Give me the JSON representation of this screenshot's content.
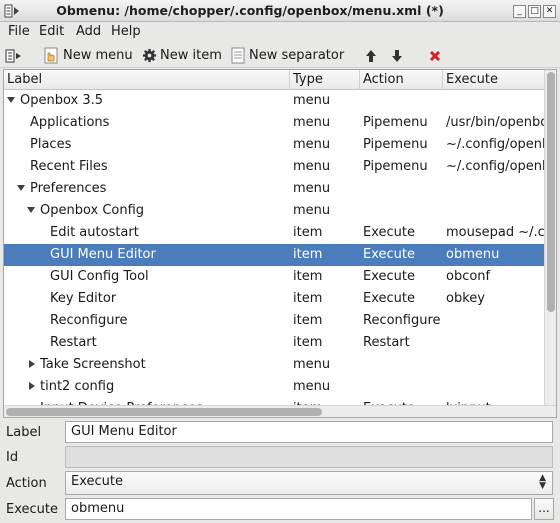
{
  "window": {
    "title": "Obmenu: /home/chopper/.config/openbox/menu.xml (*)",
    "buttons": [
      "_",
      "□",
      "✕"
    ]
  },
  "menubar": [
    "File",
    "Edit",
    "Add",
    "Help"
  ],
  "toolbar": {
    "new_menu": "New menu",
    "new_item": "New item",
    "new_separator": "New separator"
  },
  "tree": {
    "columns": [
      "Label",
      "Type",
      "Action",
      "Execute"
    ],
    "rows": [
      {
        "label": "Openbox 3.5",
        "type": "menu",
        "action": "",
        "execute": "",
        "depth": 0,
        "expander": "expanded"
      },
      {
        "label": "Applications",
        "type": "menu",
        "action": "Pipemenu",
        "execute": "/usr/bin/openbox",
        "depth": 1,
        "expander": "none"
      },
      {
        "label": "Places",
        "type": "menu",
        "action": "Pipemenu",
        "execute": "~/.config/openb",
        "depth": 1,
        "expander": "none"
      },
      {
        "label": "Recent Files",
        "type": "menu",
        "action": "Pipemenu",
        "execute": "~/.config/openb",
        "depth": 1,
        "expander": "none"
      },
      {
        "label": "Preferences",
        "type": "menu",
        "action": "",
        "execute": "",
        "depth": 1,
        "expander": "expanded"
      },
      {
        "label": "Openbox Config",
        "type": "menu",
        "action": "",
        "execute": "",
        "depth": 2,
        "expander": "expanded"
      },
      {
        "label": "Edit autostart",
        "type": "item",
        "action": "Execute",
        "execute": "mousepad ~/.co",
        "depth": 3,
        "expander": "none"
      },
      {
        "label": "GUI Menu Editor",
        "type": "item",
        "action": "Execute",
        "execute": "obmenu",
        "depth": 3,
        "expander": "none",
        "selected": true
      },
      {
        "label": "GUI Config Tool",
        "type": "item",
        "action": "Execute",
        "execute": "obconf",
        "depth": 3,
        "expander": "none"
      },
      {
        "label": "Key Editor",
        "type": "item",
        "action": "Execute",
        "execute": "obkey",
        "depth": 3,
        "expander": "none"
      },
      {
        "label": "Reconfigure",
        "type": "item",
        "action": "Reconfigure",
        "execute": "",
        "depth": 3,
        "expander": "none"
      },
      {
        "label": "Restart",
        "type": "item",
        "action": "Restart",
        "execute": "",
        "depth": 3,
        "expander": "none"
      },
      {
        "label": "Take Screenshot",
        "type": "menu",
        "action": "",
        "execute": "",
        "depth": 2,
        "expander": "collapsed"
      },
      {
        "label": "tint2 config",
        "type": "menu",
        "action": "",
        "execute": "",
        "depth": 2,
        "expander": "collapsed"
      },
      {
        "label": "Input Device Preferences",
        "type": "item",
        "action": "Execute",
        "execute": "lxinput",
        "depth": 2,
        "expander": "none"
      }
    ]
  },
  "form": {
    "label_caption": "Label",
    "label_value": "GUI Menu Editor",
    "id_caption": "Id",
    "id_value": "",
    "action_caption": "Action",
    "action_value": "Execute",
    "execute_caption": "Execute",
    "execute_value": "obmenu",
    "browse_button": "..."
  },
  "colors": {
    "selection": "#4b7cbb",
    "delete_icon": "#d42020"
  }
}
